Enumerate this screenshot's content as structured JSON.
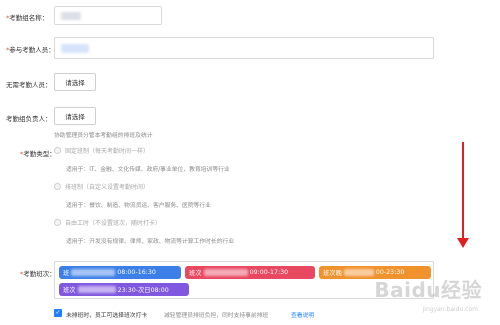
{
  "form": {
    "name": {
      "label": "考勤组名称："
    },
    "members": {
      "label": "参与考勤人员："
    },
    "excluded": {
      "label": "无需考勤人员：",
      "button": "请选择"
    },
    "owner": {
      "label": "考勤组负责人：",
      "button": "请选择",
      "hint": "协助管理员分管本考勤组的排班及统计"
    },
    "type": {
      "label": "考勤类型：",
      "options": [
        {
          "label": "固定班制（每天考勤时间一样）",
          "desc": "适用于：IT、金融、文化传媒、政府/事业单位、教育培训等行业"
        },
        {
          "label": "排班制（自定义设置考勤时间）",
          "desc": "适用于：餐饮、制造、物流货运、客户服务、医院等行业"
        },
        {
          "label": "自由工时（不设置班次，随时打卡）",
          "desc": "适用于：开发没有规律、律师、家政、物流等计算工作时长的行业"
        }
      ]
    },
    "shifts": {
      "label": "考勤班次：",
      "tags": [
        {
          "prefix": "班",
          "time": "08:00-16:30",
          "color": "#3d7fe8"
        },
        {
          "prefix": "班次",
          "time": "09:00-17:30",
          "color": "#e84860"
        },
        {
          "prefix": "班次晚",
          "time": "00-23:30",
          "color": "#f0922e"
        },
        {
          "prefix": "班次",
          "time": "23:30-次日08:00",
          "color": "#8058e0"
        }
      ]
    },
    "footer": {
      "checkbox_label": "未排班时，员工可选择班次打卡",
      "desc": "减轻管理员排班负担，同时支持事前排班",
      "link": "查看说明"
    }
  },
  "watermark": {
    "text": "Baidu经验",
    "sub": "jingyan.baidu.com"
  },
  "colors": {
    "arrow": "#e02020",
    "checkbox": "#1e80ff",
    "link": "#1e80ff"
  }
}
